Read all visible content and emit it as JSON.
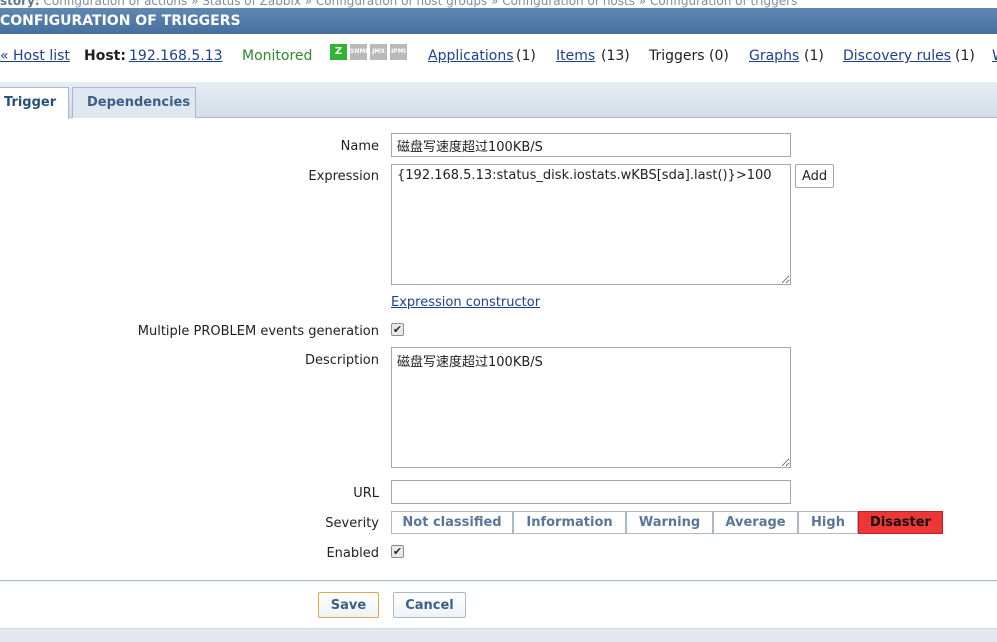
{
  "history": {
    "label": "story:",
    "trail": "Configuration of actions » Status of Zabbix » Configuration of host groups » Configuration of hosts » Configuration of triggers"
  },
  "title": "CONFIGURATION OF TRIGGERS",
  "hostbar": {
    "host_list": "« Host list",
    "host_label": "Host:",
    "host_name": "192.168.5.13",
    "status": "Monitored",
    "badges": [
      "Z",
      "SNMP",
      "JMX",
      "IPMI"
    ],
    "applications": "Applications",
    "applications_count": "(1)",
    "items": "Items",
    "items_count": "(13)",
    "triggers": "Triggers (0)",
    "graphs": "Graphs",
    "graphs_count": "(1)",
    "discovery": "Discovery rules",
    "discovery_count": "(1)",
    "web": "W"
  },
  "tabs": [
    "Trigger",
    "Dependencies"
  ],
  "form": {
    "name_label": "Name",
    "name_value": "磁盘写速度超过100KB/S",
    "expression_label": "Expression",
    "expression_value": "{192.168.5.13:status_disk.iostats.wKBS[sda].last()}>100",
    "add_label": "Add",
    "expression_constructor": "Expression constructor",
    "multiple_label": "Multiple PROBLEM events generation",
    "description_label": "Description",
    "description_value": "磁盘写速度超过100KB/S",
    "url_label": "URL",
    "url_value": "",
    "severity_label": "Severity",
    "severities": [
      "Not classified",
      "Information",
      "Warning",
      "Average",
      "High",
      "Disaster"
    ],
    "severity_selected": "Disaster",
    "enabled_label": "Enabled",
    "check_mark": "✔"
  },
  "buttons": {
    "save": "Save",
    "cancel": "Cancel"
  },
  "colors": {
    "disaster": "#ee3636",
    "link": "#1f3f8f",
    "monitored": "#2b8a2b"
  }
}
